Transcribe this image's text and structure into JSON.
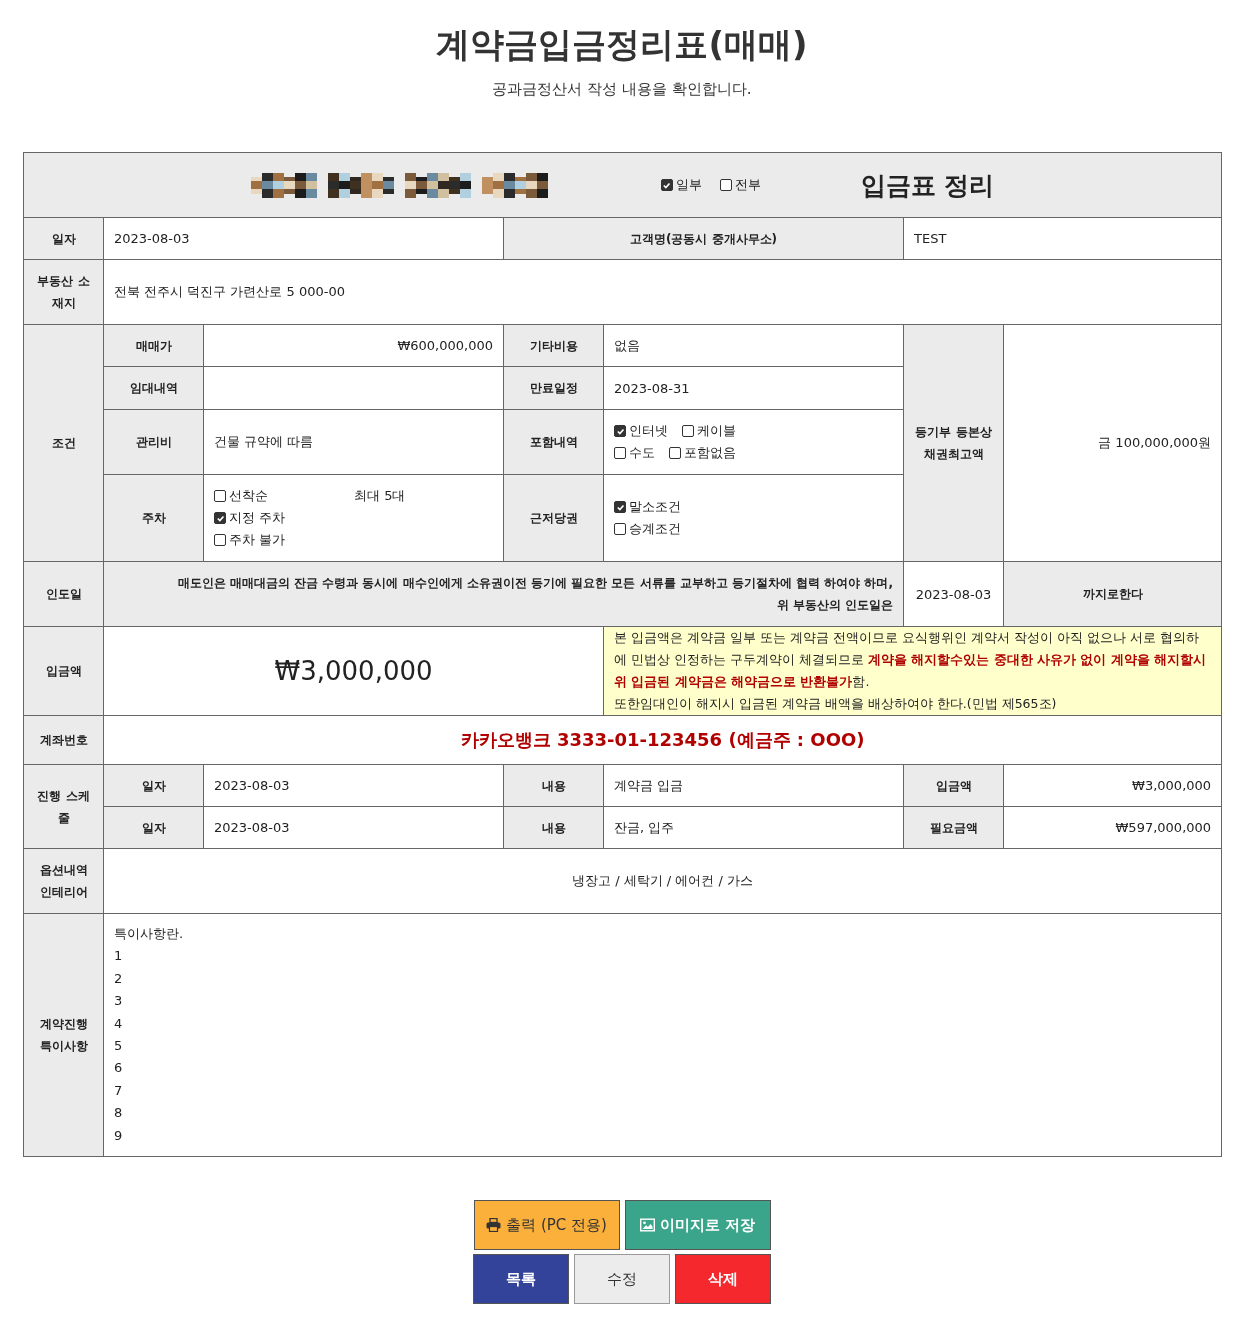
{
  "page": {
    "title": "계약금입금정리표(매매)",
    "subtitle": "공과금정산서 작성 내용을 확인합니다."
  },
  "form_header": {
    "scope_options": [
      {
        "label": "일부",
        "checked": true
      },
      {
        "label": "전부",
        "checked": false
      }
    ],
    "title": "입금표 정리"
  },
  "date_row": {
    "label": "일자",
    "value": "2023-08-03",
    "client_label": "고객명(공동시 중개사무소)",
    "client_value": "TEST"
  },
  "location": {
    "label": "부동산 소재지",
    "value": "전북 전주시 덕진구 가련산로 5 000-00"
  },
  "conditions": {
    "label": "조건",
    "sale_price": {
      "label": "매매가",
      "value": "₩600,000,000"
    },
    "other_costs": {
      "label": "기타비용",
      "value": "없음"
    },
    "lease": {
      "label": "임대내역"
    },
    "expiry": {
      "label": "만료일정",
      "value": "2023-08-31"
    },
    "maintenance": {
      "label": "관리비",
      "value": "건물 규약에 따름"
    },
    "included": {
      "label": "포함내역",
      "option_lines": [
        [
          {
            "label": "인터넷",
            "checked": true
          },
          {
            "label": "케이블",
            "checked": false
          }
        ],
        [
          {
            "label": "수도",
            "checked": false
          },
          {
            "label": "포함없음",
            "checked": false
          }
        ]
      ]
    },
    "parking": {
      "label": "주차",
      "options": [
        {
          "label": "선착순",
          "checked": false
        },
        {
          "label": "지정 주차",
          "checked": true
        },
        {
          "label": "주차 불가",
          "checked": false
        }
      ],
      "note": "최대 5대"
    },
    "mortgage": {
      "label": "근저당권",
      "options": [
        {
          "label": "말소조건",
          "checked": true
        },
        {
          "label": "승계조건",
          "checked": false
        }
      ]
    },
    "max_claim": {
      "label": "등기부 등본상 채권최고액",
      "value": "금 100,000,000원"
    }
  },
  "handover": {
    "label": "인도일",
    "text_lines": [
      "매도인은 매매대금의 잔금 수령과 동시에 매수인에게 소유권이전 등기에 필요한 모든 서류를 교부하고 등기절차에 협력 하여야 하며,",
      "위 부동산의 인도일은"
    ],
    "date": "2023-08-03",
    "suffix": "까지로한다"
  },
  "deposit": {
    "label": "입금액",
    "amount": "₩3,000,000",
    "notice_lines": [
      "본 입금액은 계약금 일부 또는 계약금 전액이므로 요식행위인 계약서 작성이 아직 없으나 서로 협의하에 민법상 인정하는 구두계약이 체결되므로 **계약을 해지할수있는 중대한 사유가 없이 계약을 해지할시 위 입금된 계약금은 해약금으로 반환불가**함.",
      "또한임대인이 해지시 입금된 계약금 배액을 배상하여야 한다.(민법 제565조)"
    ]
  },
  "account": {
    "label": "계좌번호",
    "value": "카카오뱅크 3333-01-123456 (예금주 : OOO)"
  },
  "schedule": {
    "label": "진행 스케줄",
    "rows": [
      {
        "date_label": "일자",
        "date": "2023-08-03",
        "content_label": "내용",
        "content": "계약금 입금",
        "amount_label": "입금액",
        "amount": "₩3,000,000"
      },
      {
        "date_label": "일자",
        "date": "2023-08-03",
        "content_label": "내용",
        "content": "잔금, 입주",
        "amount_label": "필요금액",
        "amount": "₩597,000,000"
      }
    ]
  },
  "options": {
    "label": "옵션내역 인테리어",
    "value": "냉장고 / 세탁기 / 에어컨 / 가스"
  },
  "notes": {
    "label": "계약진행 특이사항",
    "lines": [
      "특이사항란.",
      "1",
      "2",
      "3",
      "4",
      "5",
      "6",
      "7",
      "8",
      "9"
    ]
  },
  "button_rows": [
    [
      {
        "kind": "print",
        "label": "출력 (PC 전용)"
      },
      {
        "kind": "save_image",
        "label": "이미지로 저장"
      }
    ],
    [
      {
        "kind": "list",
        "label": "목록"
      },
      {
        "kind": "edit",
        "label": "수정"
      },
      {
        "kind": "delete",
        "label": "삭제"
      }
    ]
  ]
}
